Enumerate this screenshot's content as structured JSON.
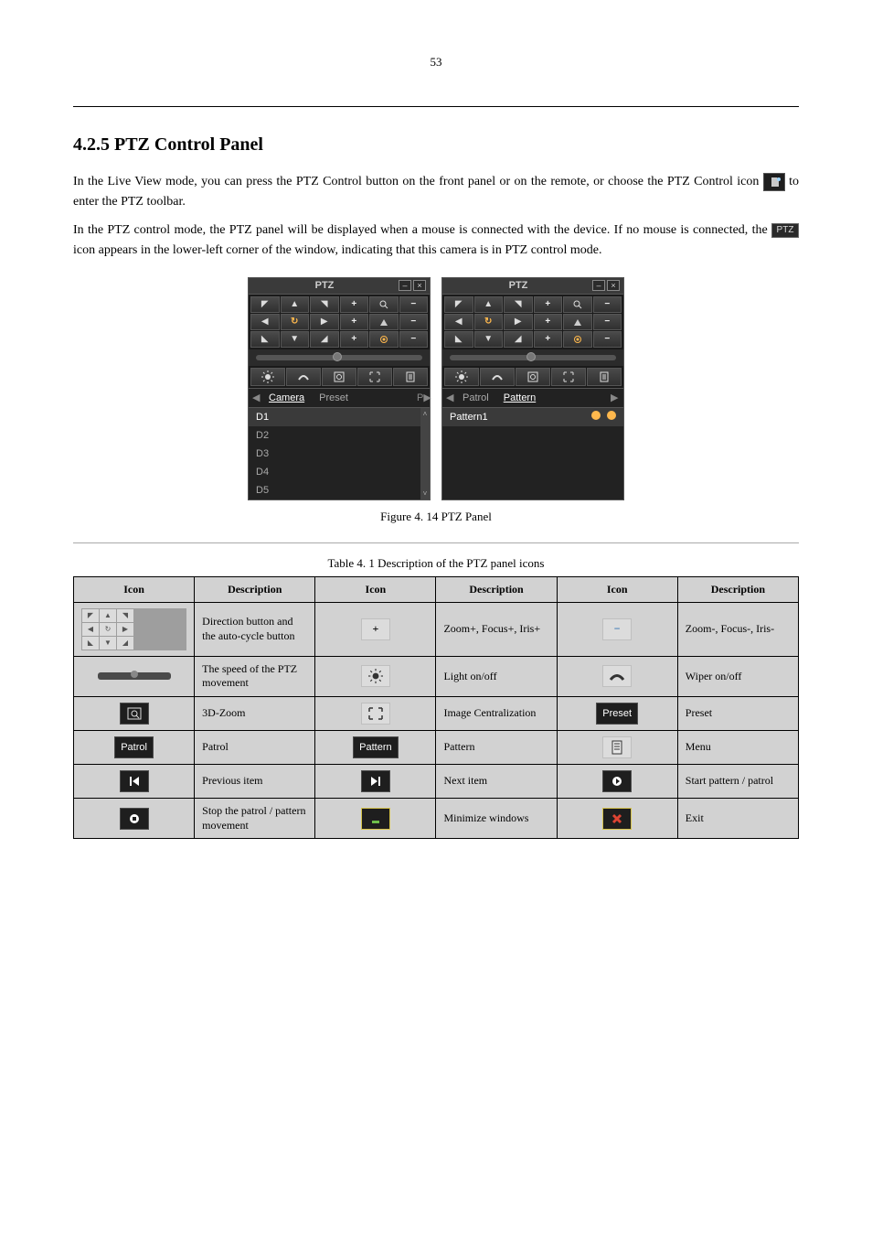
{
  "page_number": "53",
  "subsection_title": "4.2.5 PTZ Control Panel",
  "para1": "In the Live View mode, you can press the PTZ Control button on the front panel or on the remote, or choose the PTZ Control icon ",
  "para1b": " to enter the PTZ toolbar.",
  "para2": "In the PTZ control mode, the PTZ panel will be displayed when a mouse is connected with the device. If no mouse is connected, the ",
  "para2b": " icon appears in the lower-left corner of the window, indicating that this camera is in PTZ control mode.",
  "ptz_abbrev": "PTZ",
  "panel1": {
    "title": "PTZ",
    "tabs": {
      "left_arrow": "◀",
      "camera": "Camera",
      "preset": "Preset",
      "pmore": "P▶"
    },
    "list": [
      "D1",
      "D2",
      "D3",
      "D4",
      "D5"
    ]
  },
  "panel2": {
    "title": "PTZ",
    "tabs": {
      "left_arrow": "◀",
      "patrol": "Patrol",
      "pattern": "Pattern",
      "right_arrow": "▶"
    },
    "list": [
      "Pattern1"
    ]
  },
  "figure_caption_prefix": "Figure 4. 14 ",
  "figure_caption": "PTZ Panel",
  "table_caption_prefix": "Table 4. 1  ",
  "table_caption": "Description of the PTZ panel icons",
  "table": {
    "headers": [
      "Icon",
      "Description",
      "Icon",
      "Description",
      "Icon",
      "Description"
    ],
    "rows": [
      {
        "d1": "Direction button and the auto-cycle button",
        "d2": "Zoom+, Focus+, Iris+",
        "d3": "Zoom-, Focus-, Iris-"
      },
      {
        "d1": "The speed of the PTZ movement",
        "d2": "Light on/off",
        "d3": "Wiper on/off"
      },
      {
        "d1": "3D-Zoom",
        "d2": "Image Centralization",
        "d3": "Preset",
        "label3": "Preset"
      },
      {
        "d1": "Patrol",
        "d2": "Pattern",
        "d3": "Menu",
        "label1": "Patrol",
        "label2": "Pattern"
      },
      {
        "d1": "Previous item",
        "d2": "Next item",
        "d3": "Start pattern / patrol"
      },
      {
        "d1": "Stop the patrol / pattern movement",
        "d2": "Minimize windows",
        "d3": "Exit"
      }
    ]
  }
}
